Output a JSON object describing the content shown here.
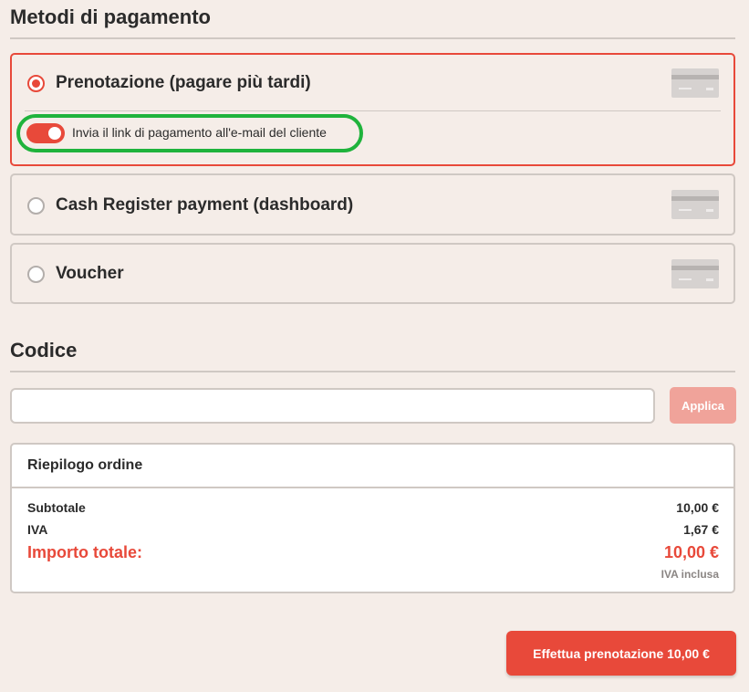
{
  "payment_methods": {
    "title": "Metodi di pagamento",
    "options": [
      {
        "label": "Prenotazione (pagare più tardi)",
        "selected": true,
        "icon": "credit-card-icon"
      },
      {
        "label": "Cash Register payment (dashboard)",
        "selected": false,
        "icon": "credit-card-icon"
      },
      {
        "label": "Voucher",
        "selected": false,
        "icon": "credit-card-icon"
      }
    ],
    "send_link_toggle": {
      "label": "Invia il link di pagamento all'e-mail del cliente",
      "on": true
    }
  },
  "code": {
    "title": "Codice",
    "input_value": "",
    "apply_label": "Applica"
  },
  "summary": {
    "title": "Riepilogo ordine",
    "subtotal_label": "Subtotale",
    "subtotal_value": "10,00 €",
    "vat_label": "IVA",
    "vat_value": "1,67 €",
    "total_label": "Importo totale:",
    "total_value": "10,00 €",
    "vat_note": "IVA inclusa"
  },
  "book_button_label": "Effettua prenotazione 10,00 €",
  "colors": {
    "accent": "#e8493a",
    "accent_disabled": "#f0a39a",
    "highlight": "#1fb33c",
    "background": "#f5ede8",
    "border": "#cfc8c3"
  }
}
